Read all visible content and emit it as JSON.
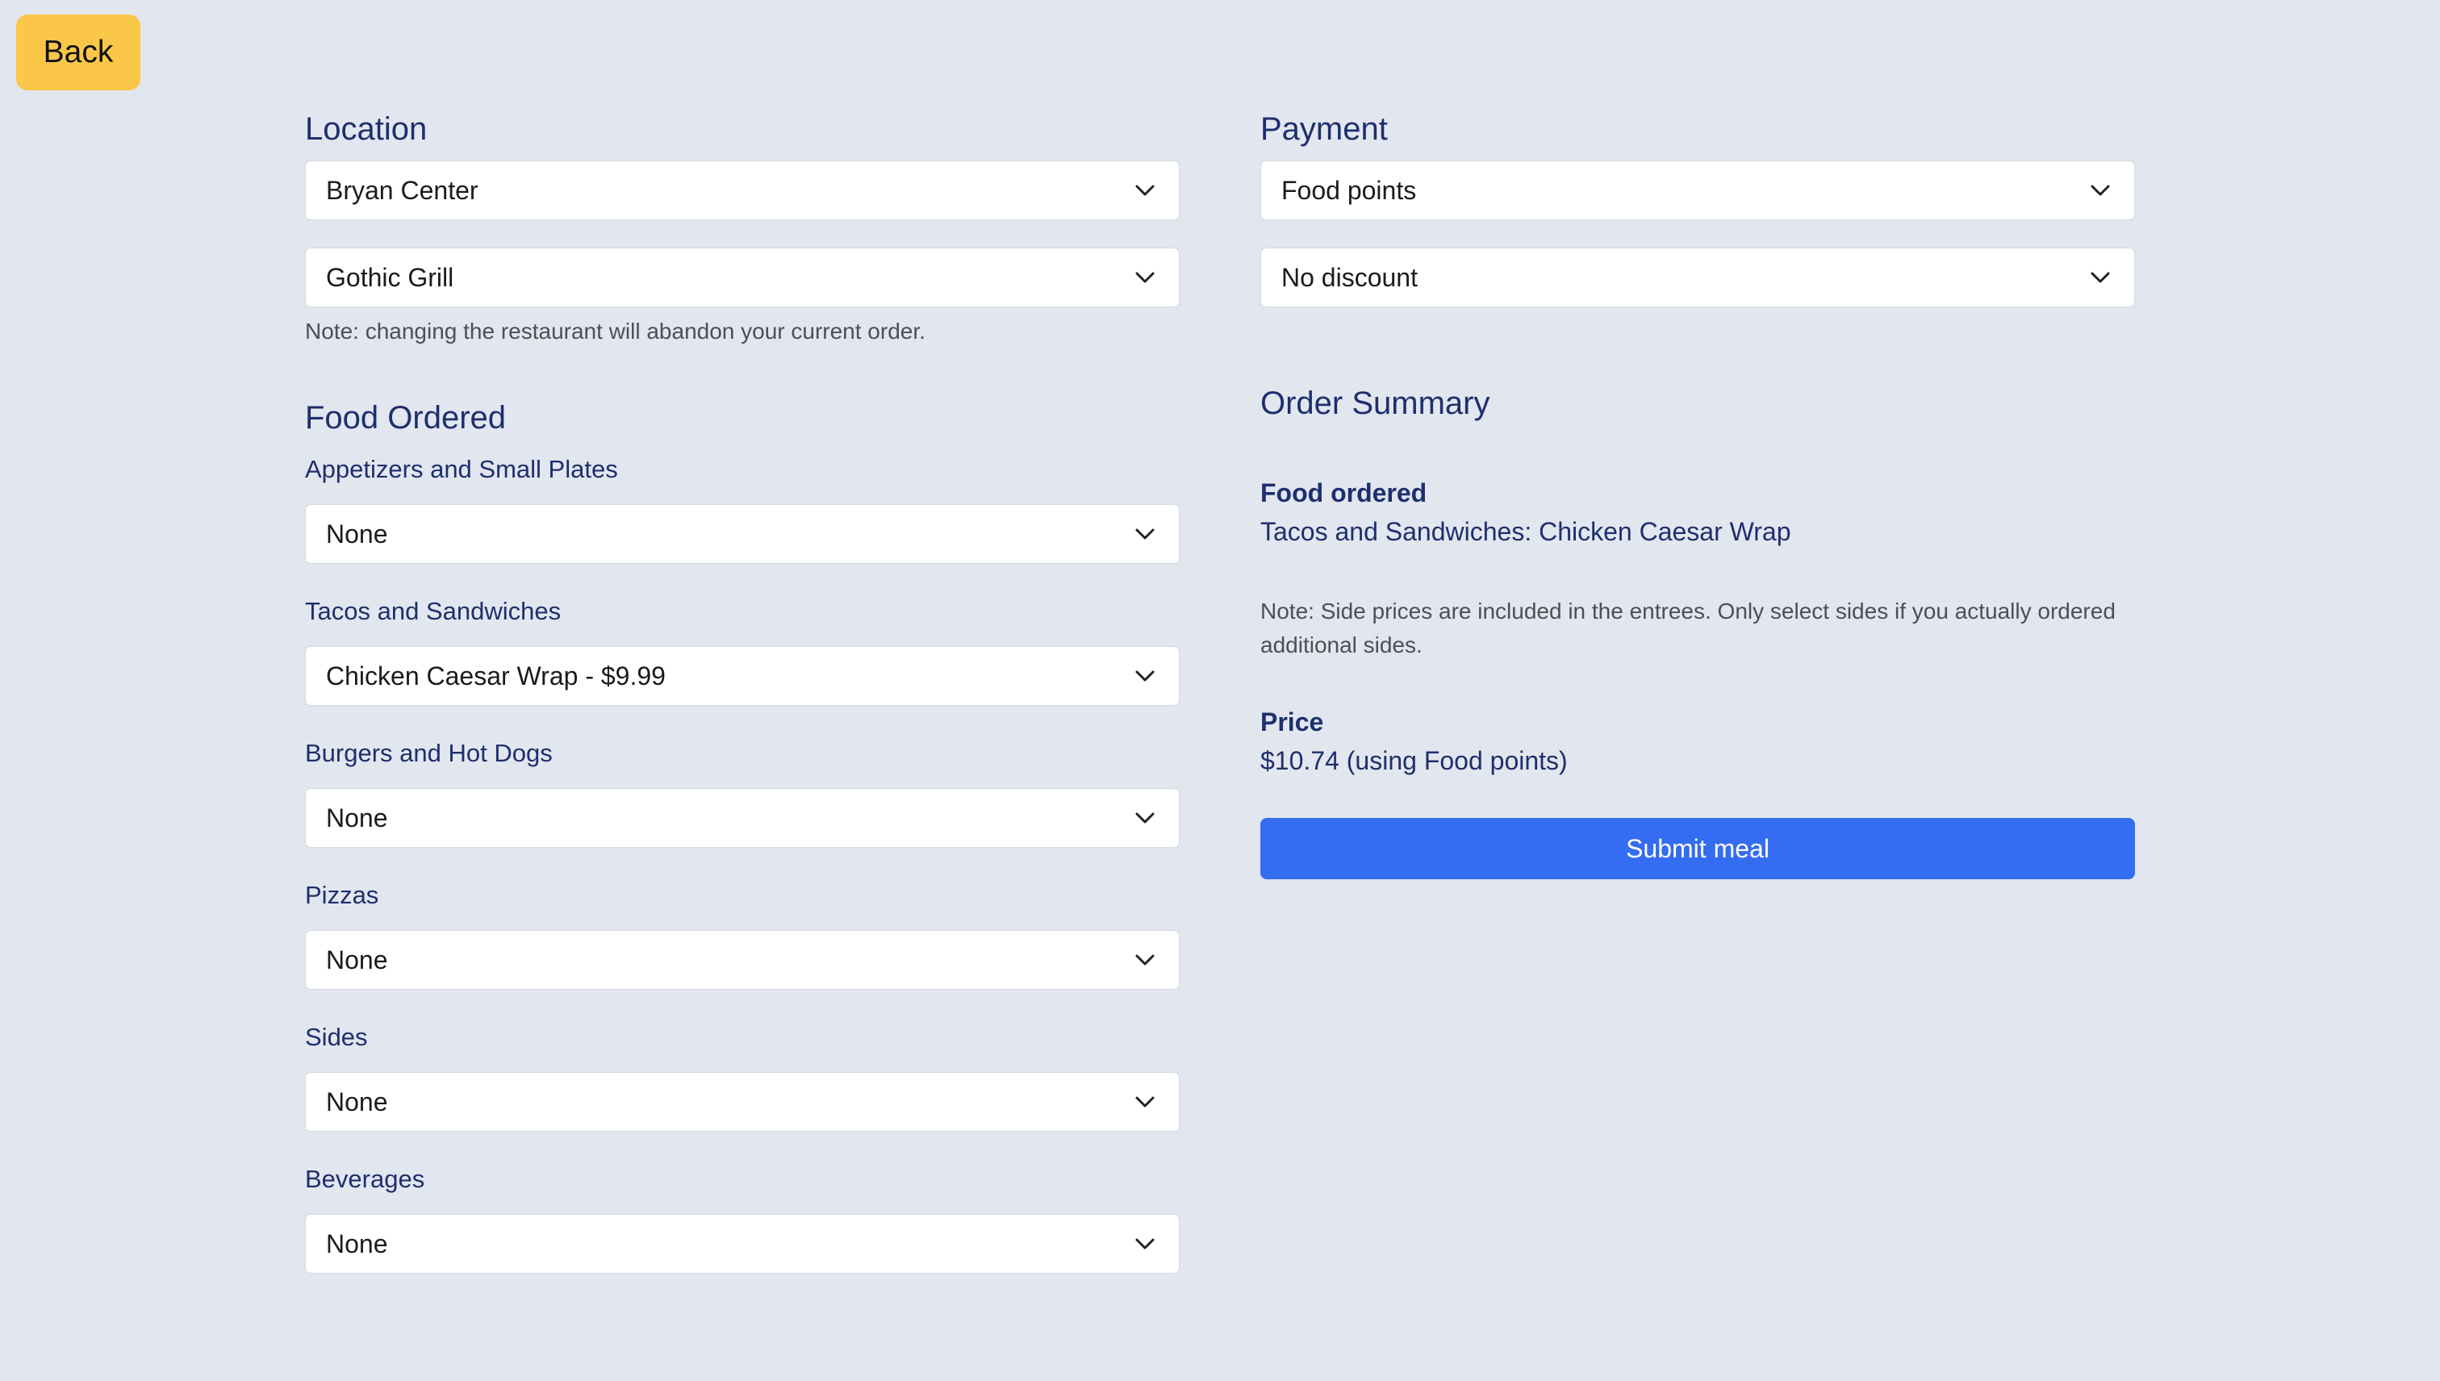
{
  "back_label": "Back",
  "location": {
    "heading": "Location",
    "area_select": "Bryan Center",
    "restaurant_select": "Gothic Grill",
    "note": "Note: changing the restaurant will abandon your current order."
  },
  "food": {
    "heading": "Food Ordered",
    "categories": [
      {
        "label": "Appetizers and Small Plates",
        "value": "None"
      },
      {
        "label": "Tacos and Sandwiches",
        "value": "Chicken Caesar Wrap - $9.99"
      },
      {
        "label": "Burgers and Hot Dogs",
        "value": "None"
      },
      {
        "label": "Pizzas",
        "value": "None"
      },
      {
        "label": "Sides",
        "value": "None"
      },
      {
        "label": "Beverages",
        "value": "None"
      }
    ]
  },
  "payment": {
    "heading": "Payment",
    "method_select": "Food points",
    "discount_select": "No discount"
  },
  "summary": {
    "heading": "Order Summary",
    "food_label": "Food ordered",
    "food_value": "Tacos and Sandwiches: Chicken Caesar Wrap",
    "note": "Note: Side prices are included in the entrees. Only select sides if you actually ordered additional sides.",
    "price_label": "Price",
    "price_value": "$10.74 (using Food points)",
    "submit_label": "Submit meal"
  },
  "icons": {
    "select_arrow": "chevron-down-icon"
  },
  "colors": {
    "background": "#e2e6ee",
    "heading_text": "#1e2f6e",
    "back_button": "#fac748",
    "submit_button": "#346cf2"
  }
}
